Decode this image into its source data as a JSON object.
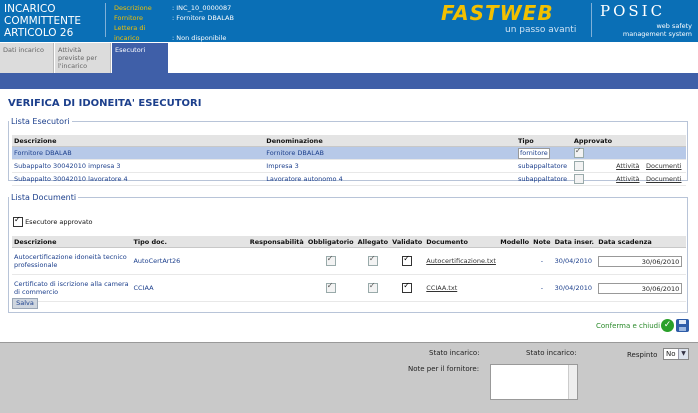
{
  "header": {
    "title_lines": [
      "INCARICO",
      "COMMITTENTE",
      "ARTICOLO 26"
    ],
    "fields": [
      {
        "label": "Descrizione",
        "value": ": INC_10_0000087"
      },
      {
        "label": "Fornitore",
        "value": ": Fornitore DBALAB"
      },
      {
        "label": "Lettera di incarico",
        "value": ": Non disponibile"
      }
    ],
    "brand": {
      "name": "FASTWEB",
      "tagline": "un passo avanti"
    },
    "posic": {
      "name": "POSIC",
      "sub1": "web safety",
      "sub2": "management system"
    }
  },
  "tabs": [
    {
      "label": "Dati incarico",
      "active": false
    },
    {
      "label": "Attività previste per l'incarico",
      "active": false
    },
    {
      "label": "Esecutori",
      "active": true
    }
  ],
  "page_title": "VERIFICA DI IDONEITA' ESECUTORI",
  "esecutori": {
    "legend": "Lista Esecutori",
    "headers": {
      "descrizione": "Descrizione",
      "denominazione": "Denominazione",
      "tipo": "Tipo",
      "approvato": "Approvato"
    },
    "rows": [
      {
        "descrizione": "Fornitore DBALAB",
        "denominazione": "Fornitore DBALAB",
        "tipo": "fornitore",
        "approvato": true,
        "attivita": "",
        "documenti": ""
      },
      {
        "descrizione": "Subappalto 30042010 impresa 3",
        "denominazione": "Impresa 3",
        "tipo": "subappaltatore",
        "approvato": false,
        "attivita": "Attività",
        "documenti": "Documenti"
      },
      {
        "descrizione": "Subappalto 30042010 lavoratore 4",
        "denominazione": "Lavoratore autonomo 4",
        "tipo": "subappaltatore",
        "approvato": false,
        "attivita": "Attività",
        "documenti": "Documenti"
      }
    ]
  },
  "documenti": {
    "legend": "Lista Documenti",
    "approved_label": "Esecutore approvato",
    "approved_checked": true,
    "headers": {
      "descrizione": "Descrizione",
      "tipo": "Tipo doc.",
      "resp": "Responsabilità",
      "obbl": "Obbligatorio",
      "alleg": "Allegato",
      "valid": "Validato",
      "doc": "Documento",
      "modello": "Modello",
      "note": "Note",
      "data_ins": "Data inser.",
      "data_scad": "Data scadenza"
    },
    "rows": [
      {
        "descrizione": "Autocertificazione idoneità tecnico professionale",
        "tipo": "AutoCertArt26",
        "obbl": true,
        "alleg": true,
        "valid": true,
        "doc": "Autocertificazione.txt",
        "note": "-",
        "data_ins": "30/04/2010",
        "data_scad": "30/06/2010"
      },
      {
        "descrizione": "Certificato di iscrizione alla camera di commercio",
        "tipo": "CCIAA",
        "obbl": true,
        "alleg": true,
        "valid": true,
        "doc": "CCIAA.txt",
        "note": "-",
        "data_ins": "30/04/2010",
        "data_scad": "30/06/2010"
      }
    ],
    "save_label": "Salva"
  },
  "confirm_label": "Conferma e chiudi",
  "footer": {
    "stato1": "Stato incarico:",
    "stato2": "Stato incarico:",
    "respinto": "Respinto",
    "respinto_value": "No",
    "note_label": "Note per il fornitore:"
  },
  "colors": {
    "header_blue": "#0a6fb6",
    "tab_blue": "#3f5fa8",
    "brand_yellow": "#f2c000",
    "link_blue": "#1c3f8c"
  }
}
